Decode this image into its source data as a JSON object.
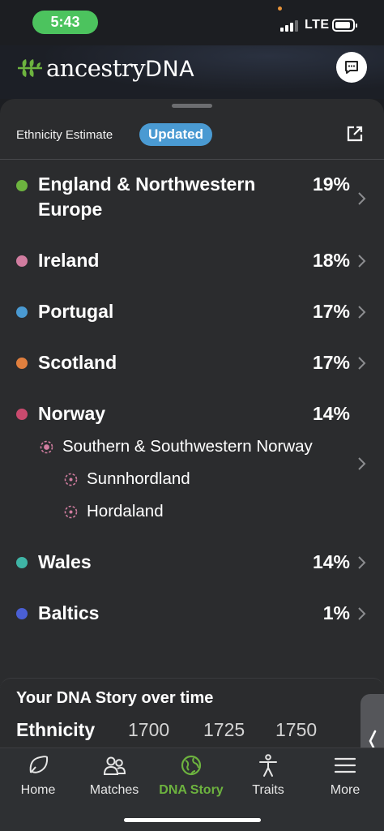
{
  "status_bar": {
    "time": "5:43",
    "network": "LTE"
  },
  "header": {
    "logo_text": "ancestry",
    "logo_dna": "DNA",
    "logo_icon": "leaf-icon",
    "chat_icon": "chat-icon"
  },
  "card": {
    "title": "Ethnicity Estimate",
    "badge": "Updated",
    "share_icon": "external-link-icon"
  },
  "ethnicities": [
    {
      "name_line1": "England & Northwestern",
      "name_line2": "Europe",
      "percent": "19%",
      "color": "#6db33f"
    },
    {
      "name": "Ireland",
      "percent": "18%",
      "color": "#d17da0"
    },
    {
      "name": "Portugal",
      "percent": "17%",
      "color": "#4a9ad2"
    },
    {
      "name": "Scotland",
      "percent": "17%",
      "color": "#e07f3e"
    },
    {
      "name": "Norway",
      "percent": "14%",
      "color": "#c94a6e",
      "sub_regions": [
        {
          "name": "Southern & Southwestern Norway"
        },
        {
          "name": "Sunnhordland"
        },
        {
          "name": "Hordaland"
        }
      ]
    },
    {
      "name": "Wales",
      "percent": "14%",
      "color": "#3fb5a6"
    },
    {
      "name": "Baltics",
      "percent": "1%",
      "color": "#4a5fd4"
    }
  ],
  "story": {
    "title": "Your DNA Story over time",
    "tabs": [
      "Ethnicity",
      "1700",
      "1725",
      "1750"
    ],
    "active_tab": "Ethnicity"
  },
  "bottom_nav": [
    {
      "label": "Home",
      "icon": "home-leaf-icon"
    },
    {
      "label": "Matches",
      "icon": "people-icon"
    },
    {
      "label": "DNA Story",
      "icon": "globe-icon",
      "active": true
    },
    {
      "label": "Traits",
      "icon": "person-icon"
    },
    {
      "label": "More",
      "icon": "menu-icon"
    }
  ],
  "colors": {
    "accent_green": "#6db33f",
    "badge_blue": "#4a9ad2",
    "time_pill": "#4cc35e"
  }
}
